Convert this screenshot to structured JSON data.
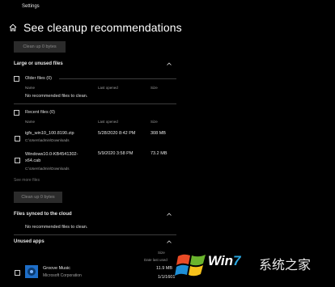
{
  "window": {
    "title": "Settings"
  },
  "header": {
    "title": "See cleanup recommendations"
  },
  "top_button": {
    "label": "Clean up 0 bytes"
  },
  "large_unused": {
    "title": "Large or unused files",
    "older_files": {
      "label": "Older files (0)",
      "columns": [
        "Name",
        "Last opened",
        "Size"
      ],
      "empty_text": "No recommended files to clean."
    },
    "recent_files": {
      "label": "Recent files (0)",
      "columns": [
        "Name",
        "Last opened",
        "Size"
      ],
      "rows": [
        {
          "name": "igfx_win10_100.8190.zip",
          "path": "C:\\Users\\admin\\Downloads",
          "date": "5/28/2020 8:42 PM",
          "size": "308 MB"
        },
        {
          "name": "Windows10.0-KB4541302-x64.cab",
          "path": "C:\\Users\\admin\\Downloads",
          "date": "5/9/2020 3:58 PM",
          "size": "73.2 MB"
        }
      ]
    },
    "see_more": "See more files",
    "button": "Clean up 0 bytes"
  },
  "synced": {
    "title": "Files synced to the cloud",
    "empty_text": "No recommended files to clean."
  },
  "unused_apps": {
    "title": "Unused apps",
    "columns": [
      "Size",
      "Date last used"
    ],
    "apps": [
      {
        "name": "Groove Music",
        "publisher": "Microsoft Corporation",
        "size": "11.9 MB",
        "date": "1/1/1601"
      }
    ]
  },
  "watermark": {
    "brand_a": "Win",
    "brand_b": "7",
    "brand_cn": "系统之家"
  },
  "colors": {
    "background": "#000000",
    "app_icon": "#1e6ec8",
    "button_bg": "#2b2b2b"
  }
}
